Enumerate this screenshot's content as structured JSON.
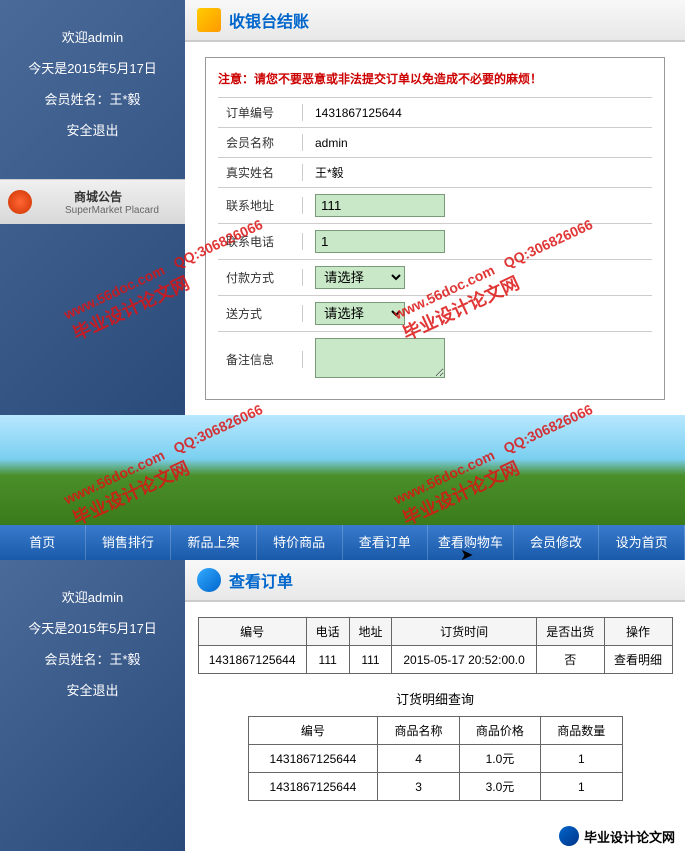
{
  "sidebar": {
    "welcome": "欢迎admin",
    "date": "今天是2015年5月17日",
    "member": "会员姓名：王*毅",
    "logout": "安全退出"
  },
  "placard": {
    "title": "商城公告",
    "sub": "SuperMarket Placard"
  },
  "checkout": {
    "title": "收银台结账",
    "warning": "注意：请您不要恶意或非法提交订单以免造成不必要的麻烦！",
    "fields": {
      "order_no_label": "订单编号",
      "order_no": "1431867125644",
      "member_name_label": "会员名称",
      "member_name": "admin",
      "real_name_label": "真实姓名",
      "real_name": "王*毅",
      "address_label": "联系地址",
      "address": "111",
      "phone_label": "联系电话",
      "phone": "1",
      "pay_label": "付款方式",
      "pay_placeholder": "请选择",
      "ship_label": "送方式",
      "ship_placeholder": "请选择",
      "remark_label": "备注信息"
    }
  },
  "nav": [
    "首页",
    "销售排行",
    "新品上架",
    "特价商品",
    "查看订单",
    "查看购物车",
    "会员修改",
    "设为首页"
  ],
  "order_view": {
    "title": "查看订单",
    "headers": [
      "编号",
      "电话",
      "地址",
      "订货时间",
      "是否出货",
      "操作"
    ],
    "rows": [
      [
        "1431867125644",
        "111",
        "111",
        "2015-05-17 20:52:00.0",
        "否",
        "查看明细"
      ]
    ]
  },
  "detail": {
    "title": "订货明细查询",
    "headers": [
      "编号",
      "商品名称",
      "商品价格",
      "商品数量"
    ],
    "rows": [
      [
        "1431867125644",
        "4",
        "1.0元",
        "1"
      ],
      [
        "1431867125644",
        "3",
        "3.0元",
        "1"
      ]
    ]
  },
  "watermark": {
    "url": "www.56doc.com",
    "qq": "QQ:306826066",
    "cn": "毕业设计论文网"
  },
  "footer": "毕业设计论文网"
}
